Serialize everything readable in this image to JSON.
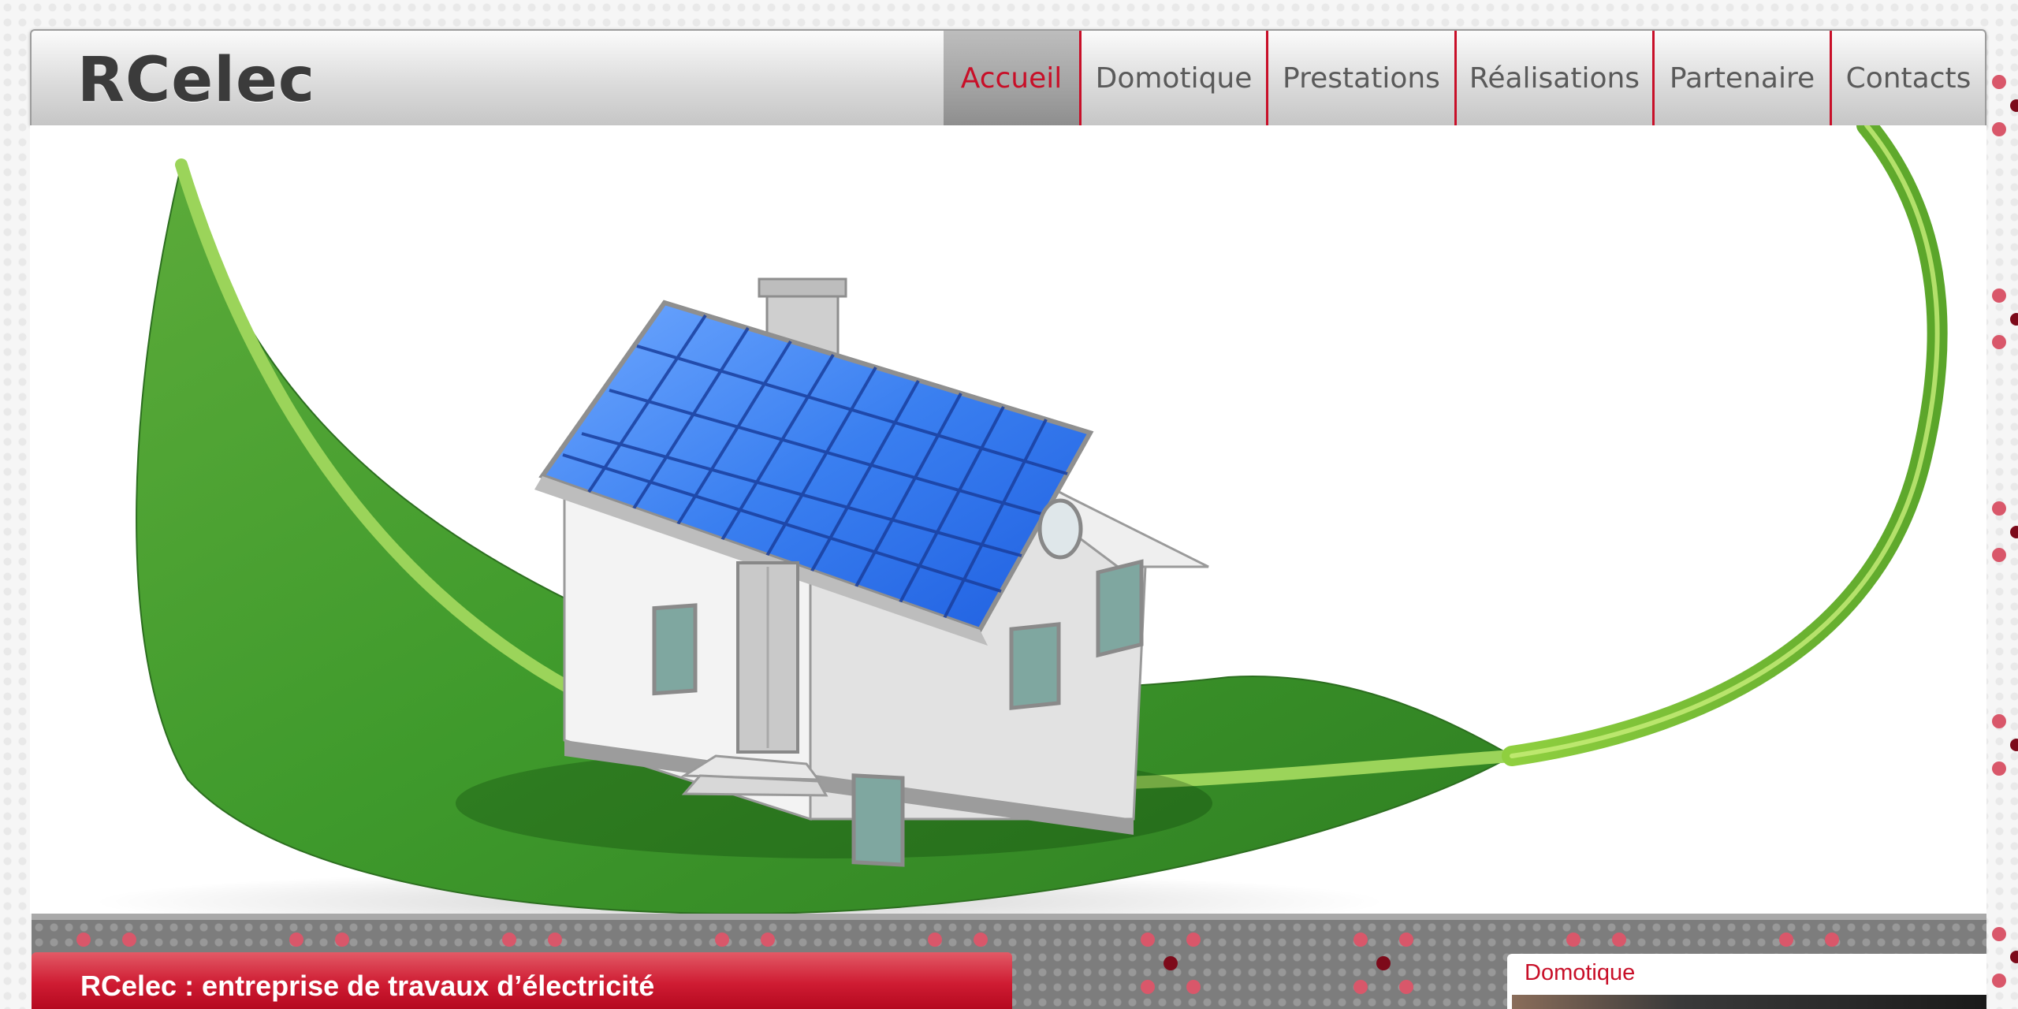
{
  "header": {
    "logo_text": "RCelec",
    "nav": [
      {
        "label": "Accueil",
        "active": true
      },
      {
        "label": "Domotique",
        "active": false
      },
      {
        "label": "Prestations",
        "active": false
      },
      {
        "label": "Réalisations",
        "active": false
      },
      {
        "label": "Partenaire",
        "active": false
      },
      {
        "label": "Contacts",
        "active": false
      }
    ]
  },
  "hero": {
    "image_icon": "house-on-leaf-solar-illustration"
  },
  "intro": {
    "title": "RCelec : entreprise de travaux d’électricité"
  },
  "sidebar": {
    "domotique_label": "Domotique"
  },
  "colors": {
    "accent": "#c80f28",
    "nav_text": "#5a5a5a",
    "logo": "#3b3b3b"
  }
}
